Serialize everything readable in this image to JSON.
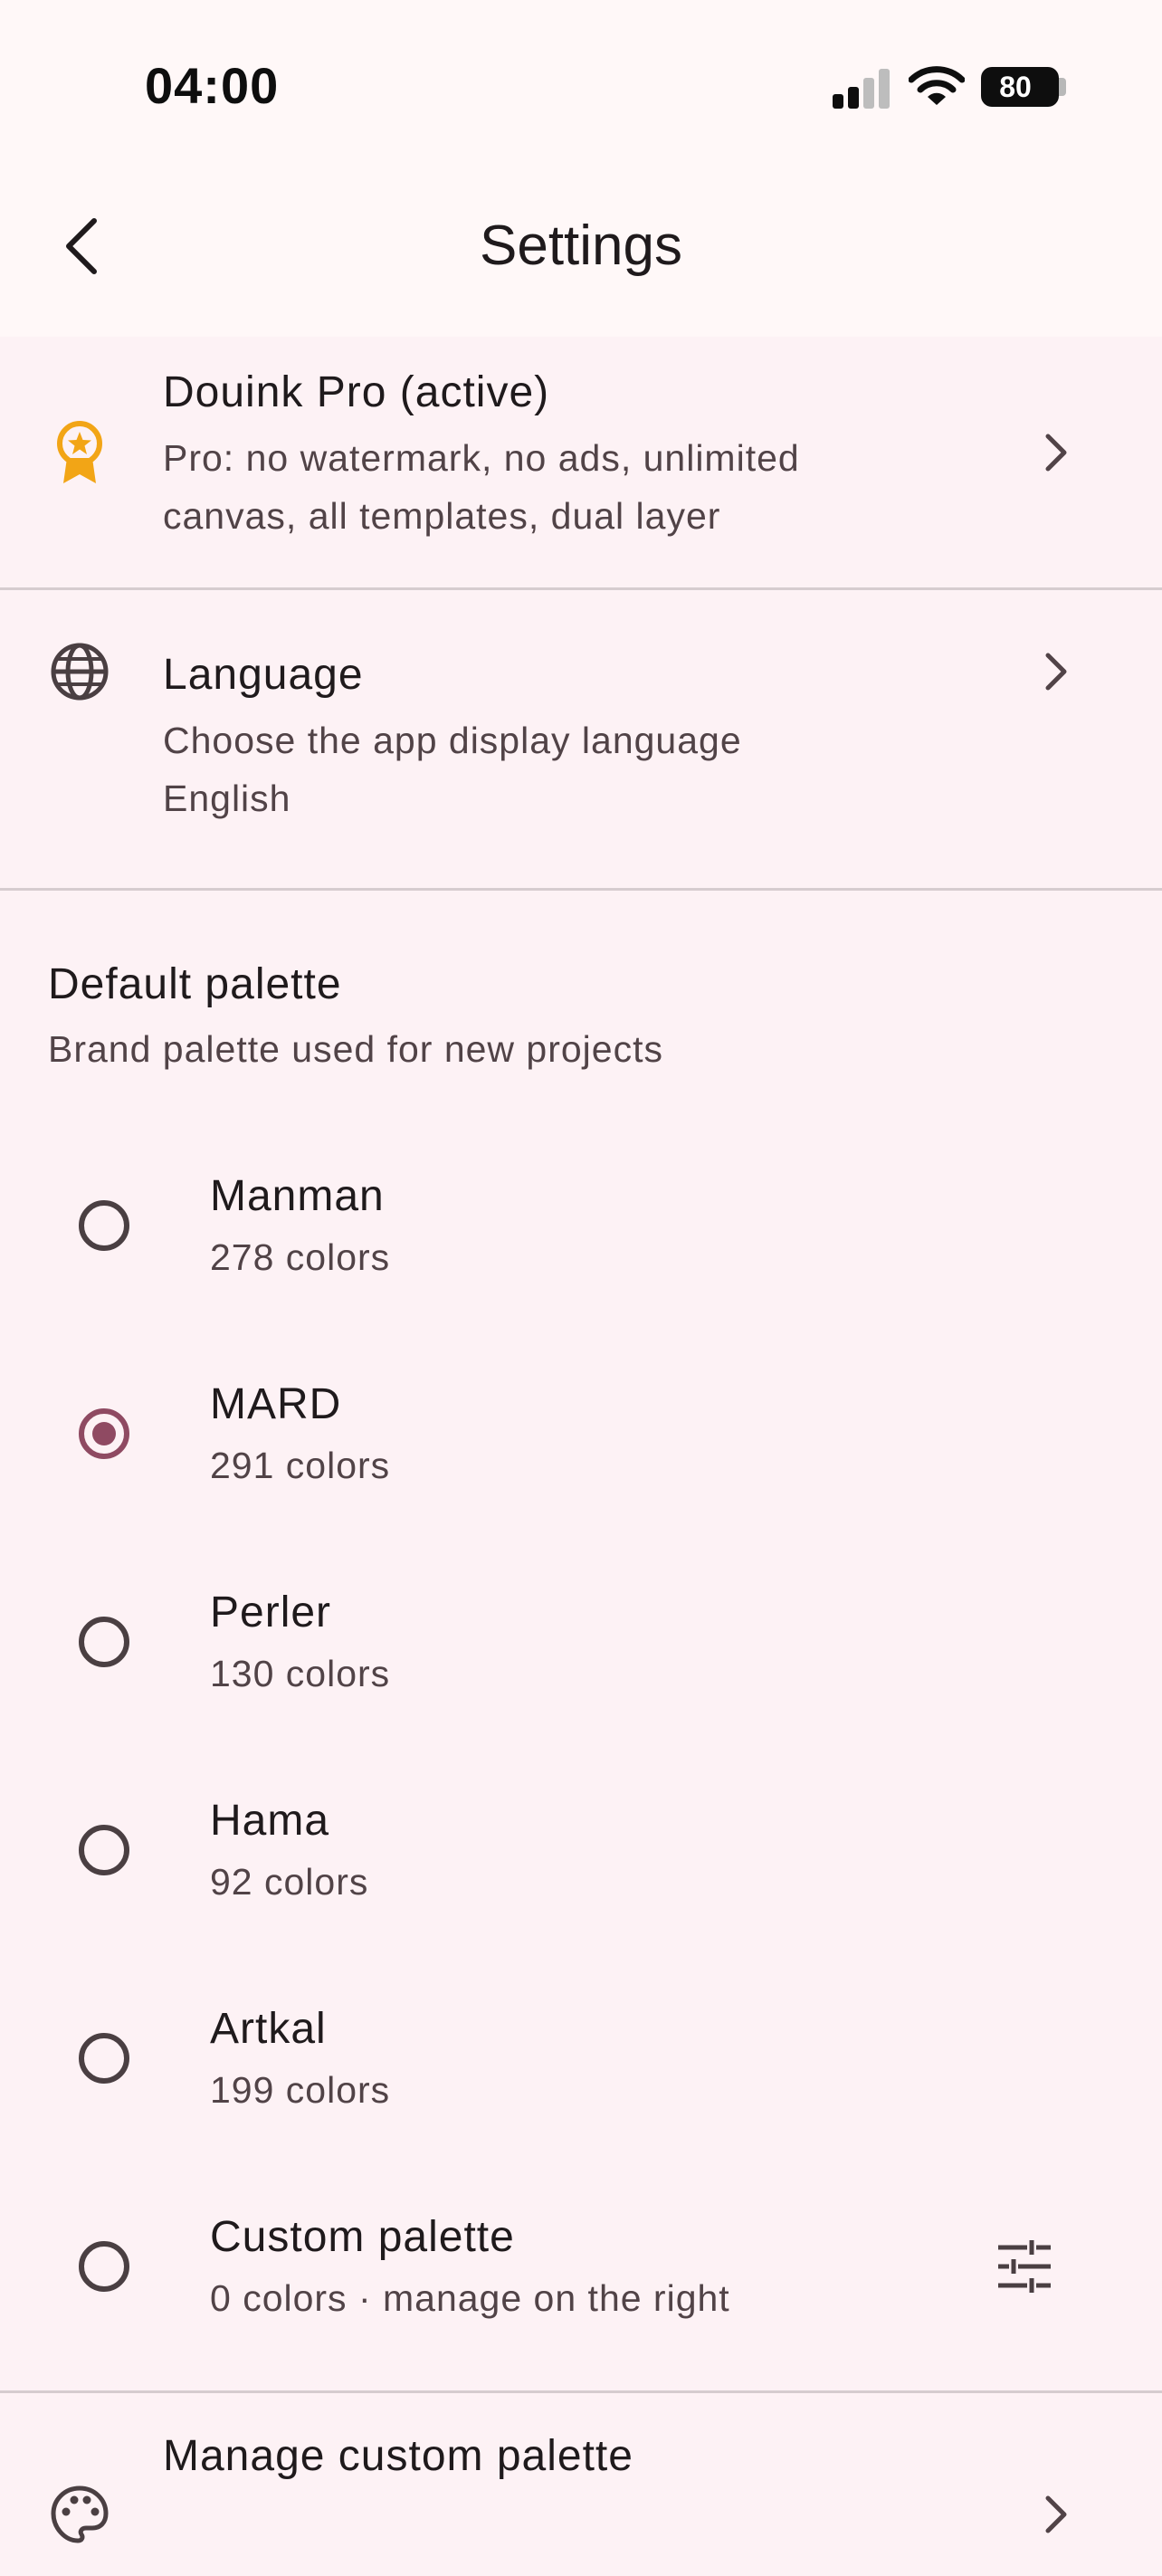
{
  "status_bar": {
    "time": "04:00",
    "battery": "80"
  },
  "header": {
    "title": "Settings",
    "back_icon": "chevron-left-icon"
  },
  "pro_row": {
    "icon": "award-icon",
    "title": "Douink Pro (active)",
    "subtitle_line1": "Pro: no watermark, no ads, unlimited",
    "subtitle_line2": "canvas, all templates, dual layer",
    "accent_color": "#f2a516"
  },
  "language_row": {
    "icon": "globe-icon",
    "title": "Language",
    "subtitle": "Choose the app display language",
    "value": "English"
  },
  "palette_section": {
    "title": "Default palette",
    "subtitle": "Brand palette used for new projects",
    "selected_color": "#8f4a62",
    "options": [
      {
        "name": "Manman",
        "count": "278 colors",
        "selected": false
      },
      {
        "name": "MARD",
        "count": "291 colors",
        "selected": true
      },
      {
        "name": "Perler",
        "count": "130 colors",
        "selected": false
      },
      {
        "name": "Hama",
        "count": "92 colors",
        "selected": false
      },
      {
        "name": "Artkal",
        "count": "199 colors",
        "selected": false
      },
      {
        "name": "Custom palette",
        "count": "0 colors · manage on the right",
        "selected": false
      }
    ]
  },
  "manage_row": {
    "icon": "palette-icon",
    "title": "Manage custom palette"
  }
}
